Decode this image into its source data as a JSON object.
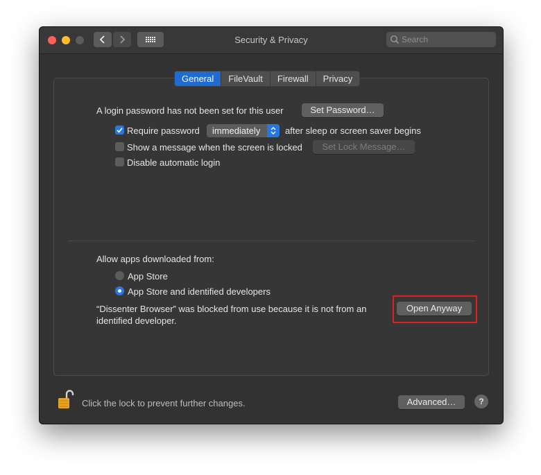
{
  "window": {
    "title": "Security & Privacy"
  },
  "search": {
    "placeholder": "Search"
  },
  "tabs": [
    {
      "label": "General",
      "active": true
    },
    {
      "label": "FileVault",
      "active": false
    },
    {
      "label": "Firewall",
      "active": false
    },
    {
      "label": "Privacy",
      "active": false
    }
  ],
  "general": {
    "login_text": "A login password has not been set for this user",
    "set_password_label": "Set Password…",
    "require_password_label": "Require password",
    "require_password_checked": true,
    "require_password_value": "immediately",
    "after_sleep_text": "after sleep or screen saver begins",
    "show_message_label": "Show a message when the screen is locked",
    "show_message_checked": false,
    "set_lock_message_label": "Set Lock Message…",
    "disable_login_label": "Disable automatic login",
    "disable_login_checked": false
  },
  "apps": {
    "heading": "Allow apps downloaded from:",
    "option_app_store": "App Store",
    "option_identified": "App Store and identified developers",
    "selected": "App Store and identified developers",
    "blocked_line1": "“Dissenter Browser” was blocked from use because it is not from an",
    "blocked_line2": "identified developer.",
    "open_anyway_label": "Open Anyway"
  },
  "footer": {
    "lock_text": "Click the lock to prevent further changes.",
    "advanced_label": "Advanced…",
    "help_label": "?"
  },
  "colors": {
    "accent": "#2877e0",
    "highlight_box": "#e0201d",
    "lock": "#e8a320"
  },
  "icons": [
    "close-light",
    "minimize-light",
    "zoom-light",
    "back-chevron-icon",
    "forward-chevron-icon",
    "grid-icon",
    "search-icon",
    "padlock-open-icon",
    "help-icon"
  ]
}
